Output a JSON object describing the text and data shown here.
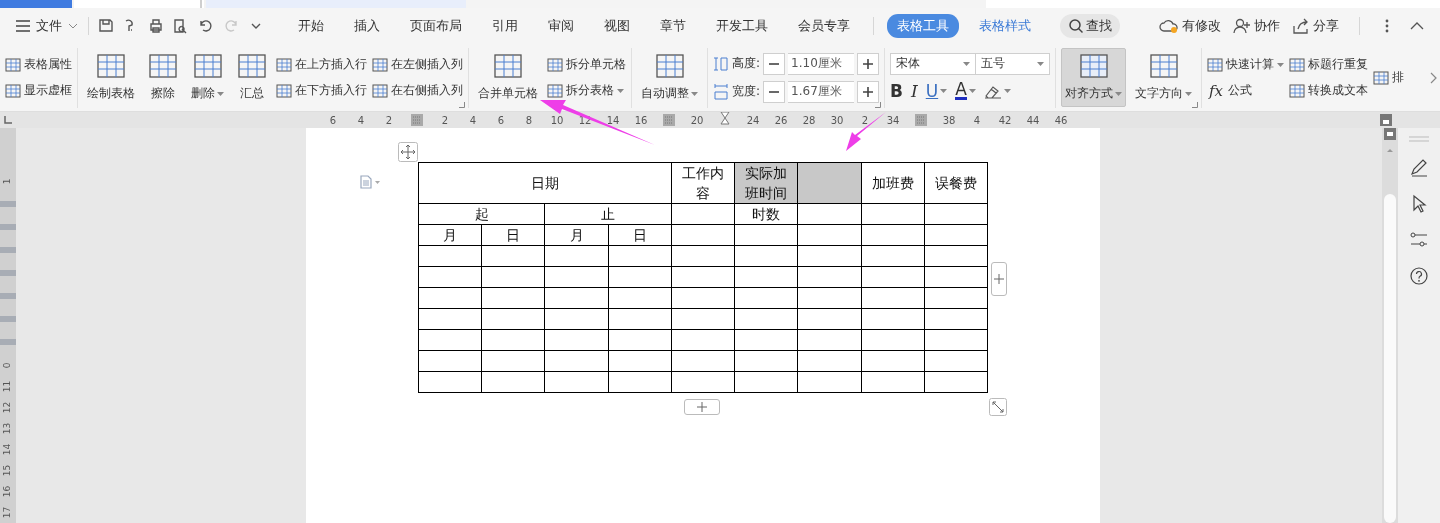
{
  "menu": {
    "file_label": "文件",
    "quick_access": [
      {
        "disabled": false
      },
      {
        "disabled": false
      },
      {
        "disabled": false
      },
      {
        "disabled": false
      },
      {
        "disabled": false
      },
      {
        "disabled": true
      },
      {
        "disabled": false
      }
    ],
    "tabs": [
      {
        "label": "开始",
        "kind": "main",
        "selected": false
      },
      {
        "label": "插入",
        "kind": "main",
        "selected": false
      },
      {
        "label": "页面布局",
        "kind": "main",
        "selected": false
      },
      {
        "label": "引用",
        "kind": "main",
        "selected": false
      },
      {
        "label": "审阅",
        "kind": "main",
        "selected": false
      },
      {
        "label": "视图",
        "kind": "main",
        "selected": false
      },
      {
        "label": "章节",
        "kind": "main",
        "selected": false
      },
      {
        "label": "开发工具",
        "kind": "main",
        "selected": false
      },
      {
        "label": "会员专享",
        "kind": "main",
        "selected": false
      },
      {
        "label": "表格工具",
        "kind": "context",
        "selected": true
      },
      {
        "label": "表格样式",
        "kind": "context",
        "selected": false
      }
    ],
    "search_label": "查找",
    "actions": [
      "有修改",
      "协作",
      "分享"
    ]
  },
  "ribbon": [
    {
      "launcher": false,
      "items": [
        {
          "kind": "stack",
          "items": [
            {
              "label": "表格属性",
              "dropdown": false
            },
            {
              "label": "显示虚框",
              "dropdown": false
            }
          ]
        }
      ]
    },
    {
      "launcher": true,
      "items": [
        {
          "kind": "big",
          "label": "绘制表格",
          "dropdown": false,
          "pressed": false
        },
        {
          "kind": "big",
          "label": "擦除",
          "dropdown": false,
          "pressed": false
        },
        {
          "kind": "big",
          "label": "删除",
          "dropdown": true,
          "pressed": false
        },
        {
          "kind": "big",
          "label": "汇总",
          "dropdown": false,
          "pressed": false
        },
        {
          "kind": "stack",
          "items": [
            {
              "label": "在上方插入行",
              "dropdown": false
            },
            {
              "label": "在下方插入行",
              "dropdown": false
            }
          ]
        },
        {
          "kind": "stack",
          "items": [
            {
              "label": "在左侧插入列",
              "dropdown": false
            },
            {
              "label": "在右侧插入列",
              "dropdown": false
            }
          ]
        }
      ]
    },
    {
      "launcher": false,
      "items": [
        {
          "kind": "big",
          "label": "合并单元格",
          "dropdown": false,
          "pressed": false
        },
        {
          "kind": "stack",
          "items": [
            {
              "label": "拆分单元格",
              "dropdown": false
            },
            {
              "label": "拆分表格",
              "dropdown": true
            }
          ]
        }
      ]
    },
    {
      "launcher": false,
      "items": [
        {
          "kind": "big",
          "label": "自动调整",
          "dropdown": true,
          "pressed": false
        }
      ]
    },
    {
      "launcher": true,
      "items": [
        {
          "kind": "spins",
          "items": [
            {
              "label": "高度:",
              "value": "1.10厘米"
            },
            {
              "label": "宽度:",
              "value": "1.67厘米"
            }
          ]
        }
      ]
    },
    {
      "launcher": false,
      "items": [
        {
          "kind": "font",
          "font": "宋体",
          "size": "五号",
          "formats": [
            {
              "glyph": "B",
              "dropdown": false
            },
            {
              "glyph": "I",
              "dropdown": false
            },
            {
              "glyph": "U",
              "dropdown": true
            },
            {
              "glyph": "A",
              "dropdown": true
            }
          ]
        }
      ]
    },
    {
      "launcher": true,
      "items": [
        {
          "kind": "big",
          "label": "对齐方式",
          "dropdown": true,
          "pressed": true
        },
        {
          "kind": "big",
          "label": "文字方向",
          "dropdown": true,
          "pressed": false
        }
      ]
    },
    {
      "launcher": false,
      "items": [
        {
          "kind": "stack",
          "items": [
            {
              "label": "快速计算",
              "dropdown": true
            },
            {
              "label": "公式",
              "glyph": "fx",
              "dropdown": false
            }
          ]
        },
        {
          "kind": "stack",
          "items": [
            {
              "label": "标题行重复",
              "dropdown": false
            },
            {
              "label": "转换成文本",
              "dropdown": false
            }
          ]
        },
        {
          "kind": "stack",
          "items": [
            {
              "label": "排",
              "dropdown": false
            }
          ]
        }
      ]
    }
  ],
  "ruler": [
    {
      "kind": "label",
      "text": "6"
    },
    {
      "kind": "label",
      "text": "4"
    },
    {
      "kind": "label",
      "text": "2"
    },
    {
      "kind": "grid"
    },
    {
      "kind": "label",
      "text": "2"
    },
    {
      "kind": "label",
      "text": "4"
    },
    {
      "kind": "label",
      "text": "6"
    },
    {
      "kind": "label",
      "text": "8"
    },
    {
      "kind": "label",
      "text": "10"
    },
    {
      "kind": "label",
      "text": "12"
    },
    {
      "kind": "label",
      "text": "14"
    },
    {
      "kind": "label",
      "text": "16"
    },
    {
      "kind": "grid"
    },
    {
      "kind": "label",
      "text": "20"
    },
    {
      "kind": "marker"
    },
    {
      "kind": "label",
      "text": "24"
    },
    {
      "kind": "label",
      "text": "26"
    },
    {
      "kind": "label",
      "text": "28"
    },
    {
      "kind": "label",
      "text": "30"
    },
    {
      "kind": "label",
      "text": "2"
    },
    {
      "kind": "label",
      "text": "34"
    },
    {
      "kind": "grid"
    },
    {
      "kind": "label",
      "text": "38"
    },
    {
      "kind": "label",
      "text": "4"
    },
    {
      "kind": "label",
      "text": "42"
    },
    {
      "kind": "label",
      "text": "44"
    },
    {
      "kind": "label",
      "text": "46"
    }
  ],
  "vertical_ruler": [
    "1",
    "0",
    "11",
    "12",
    "13",
    "14",
    "15",
    "16",
    "17"
  ],
  "table": {
    "rows": [
      {
        "cells": [
          {
            "text": "日期",
            "colspan": 4,
            "selected": false
          },
          {
            "text": "工作内容",
            "selected": false
          },
          {
            "text": "实际加班时间",
            "selected": true
          },
          {
            "selected": true
          },
          {
            "text": "加班费",
            "selected": false
          },
          {
            "text": "误餐费",
            "selected": false
          }
        ]
      },
      {
        "cells": [
          {
            "text": "起",
            "colspan": 2,
            "selected": false
          },
          {
            "text": "止",
            "colspan": 2,
            "selected": false
          },
          {
            "selected": false
          },
          {
            "text": "时数",
            "selected": false
          },
          {
            "selected": false
          },
          {
            "selected": false
          },
          {
            "selected": false
          }
        ]
      },
      {
        "cells": [
          {
            "text": "月",
            "selected": false
          },
          {
            "text": "日",
            "selected": false
          },
          {
            "text": "月",
            "selected": false
          },
          {
            "text": "日",
            "selected": false
          },
          {
            "selected": false
          },
          {
            "selected": false
          },
          {
            "selected": false
          },
          {
            "selected": false
          },
          {
            "selected": false
          }
        ]
      },
      {
        "cells": [
          {
            "selected": false
          },
          {
            "selected": false
          },
          {
            "selected": false
          },
          {
            "selected": false
          },
          {
            "selected": false
          },
          {
            "selected": false
          },
          {
            "selected": false
          },
          {
            "selected": false
          },
          {
            "selected": false
          }
        ]
      },
      {
        "cells": [
          {
            "selected": false
          },
          {
            "selected": false
          },
          {
            "selected": false
          },
          {
            "selected": false
          },
          {
            "selected": false
          },
          {
            "selected": false
          },
          {
            "selected": false
          },
          {
            "selected": false
          },
          {
            "selected": false
          }
        ]
      },
      {
        "cells": [
          {
            "selected": false
          },
          {
            "selected": false
          },
          {
            "selected": false
          },
          {
            "selected": false
          },
          {
            "selected": false
          },
          {
            "selected": false
          },
          {
            "selected": false
          },
          {
            "selected": false
          },
          {
            "selected": false
          }
        ]
      },
      {
        "cells": [
          {
            "selected": false
          },
          {
            "selected": false
          },
          {
            "selected": false
          },
          {
            "selected": false
          },
          {
            "selected": false
          },
          {
            "selected": false
          },
          {
            "selected": false
          },
          {
            "selected": false
          },
          {
            "selected": false
          }
        ]
      },
      {
        "cells": [
          {
            "selected": false
          },
          {
            "selected": false
          },
          {
            "selected": false
          },
          {
            "selected": false
          },
          {
            "selected": false
          },
          {
            "selected": false
          },
          {
            "selected": false
          },
          {
            "selected": false
          },
          {
            "selected": false
          }
        ]
      },
      {
        "cells": [
          {
            "selected": false
          },
          {
            "selected": false
          },
          {
            "selected": false
          },
          {
            "selected": false
          },
          {
            "selected": false
          },
          {
            "selected": false
          },
          {
            "selected": false
          },
          {
            "selected": false
          },
          {
            "selected": false
          }
        ]
      },
      {
        "cells": [
          {
            "selected": false
          },
          {
            "selected": false
          },
          {
            "selected": false
          },
          {
            "selected": false
          },
          {
            "selected": false
          },
          {
            "selected": false
          },
          {
            "selected": false
          },
          {
            "selected": false
          },
          {
            "selected": false
          }
        ]
      }
    ]
  }
}
